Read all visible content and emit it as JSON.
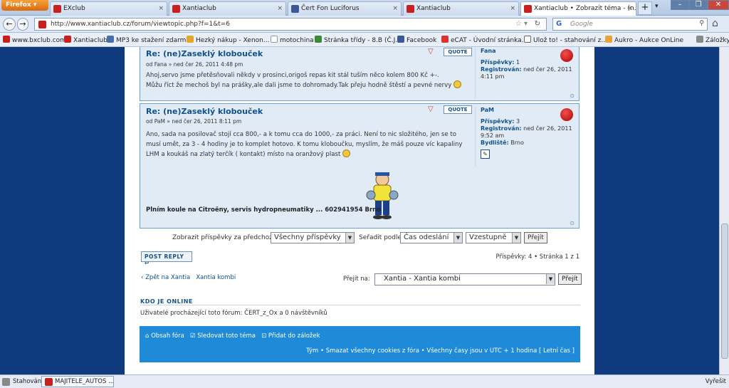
{
  "browser": {
    "menu_label": "Firefox",
    "tabs": [
      {
        "label": "EXclub",
        "active": false
      },
      {
        "label": "Xantiaclub",
        "active": false
      },
      {
        "label": "Čert Fon Luciforus",
        "active": false
      },
      {
        "label": "Xantiaclub",
        "active": false
      },
      {
        "label": "Xantiaclub • Zobrazit téma - (n...",
        "active": true
      }
    ],
    "url": "http://www.xantiaclub.cz/forum/viewtopic.php?f=1&t=6",
    "search_placeholder": "Google",
    "bookmarks": [
      "www.bxclub.com",
      "Xantiaclub",
      "MP3 ke stažení zdarma",
      "Hezký nákup - Xenon...",
      "motochina",
      "Stránka třídy - 8.B (Č.J....",
      "Facebook",
      "eCAT - Úvodní stránka...",
      "Ulož to! - stahování z...",
      "Aukro - Aukce OnLine",
      "Záložky"
    ]
  },
  "posts": [
    {
      "title": "Re: (ne)Zaseklý klobouček",
      "meta": "od Fana » ned čer 26, 2011 4:48 pm",
      "text_lines": [
        "Ahoj,servo jsme přetěsňovali někdy v prosinci,origoš repas kit stál tuším něco kolem 800 Kč +-.",
        "Můžu říct že mechoš byl na prášky,ale dali jsme to dohromady.Tak přeju hodně štěstí a pevné nervy"
      ],
      "quote_label": "QUOTE",
      "author": "Fana",
      "profile_lines": [
        {
          "label": "Příspěvky:",
          "value": "1"
        },
        {
          "label": "Registrován:",
          "value": "ned čer 26, 2011"
        },
        {
          "label": "",
          "value": "4:11 pm"
        }
      ]
    },
    {
      "title": "Re: (ne)Zaseklý klobouček",
      "meta": "od PaM » ned čer 26, 2011 8:11 pm",
      "text_lines": [
        "Ano, sada na posilovač stojí cca 800,- a k tomu cca do 1000,- za práci. Není to nic složitého, jen se to",
        "musí umět, za 3 - 4 hodiny je to komplet hotovo. K tomu kloboučku, myslím, že máš pouze víc kapaliny",
        "LHM a koukáš na zlatý terčík ( kontakt) místo na oranžový plast"
      ],
      "signature": "Plním koule na Citroëny, servis hydropneumatiky ... 602941954 Brno",
      "quote_label": "QUOTE",
      "author": "PaM",
      "profile_lines": [
        {
          "label": "Příspěvky:",
          "value": "3"
        },
        {
          "label": "Registrován:",
          "value": "ned čer 26, 2011"
        },
        {
          "label": "",
          "value": "9:52 am"
        },
        {
          "label": "Bydliště:",
          "value": "Brno"
        }
      ]
    }
  ],
  "sort": {
    "show_label": "Zobrazit příspěvky za předchozí:",
    "show_value": "Všechny příspěvky",
    "sort_label": "Seřadit podle",
    "sort_value": "Čas odeslání",
    "order_value": "Vzestupně",
    "go_label": "Přejít"
  },
  "post_reply_label": "POST REPLY",
  "page_info": "Příspěvky: 4 • Stránka 1 z 1",
  "back_links": {
    "back": "‹ Zpět na Xantia",
    "forum": "Xantia kombi"
  },
  "jump": {
    "label": "Přejít na:",
    "value": "Xantia - Xantia kombi",
    "button": "Přejít"
  },
  "who_online": {
    "title": "KDO JE ONLINE",
    "text": "Uživatelé procházející toto fórum: ČERT_z_Ox a 0 návštěvníků"
  },
  "footer": {
    "board_index": "Obsah fóra",
    "watch": "Sledovat toto téma",
    "bookmark": "Přidat do záložek",
    "team": "Tým",
    "delete_cookies": "Smazat všechny cookies z fóra",
    "timezone": "Všechny časy jsou v UTC + 1 hodina [ Letní čas ]"
  },
  "statusbar": {
    "left": "Stahování",
    "task": "MAJITELE_AUTOS ...",
    "right": "Vyřešit"
  },
  "colors": {
    "accent": "#105289",
    "footer": "#1e8ad8",
    "background": "#0f3a7d"
  }
}
